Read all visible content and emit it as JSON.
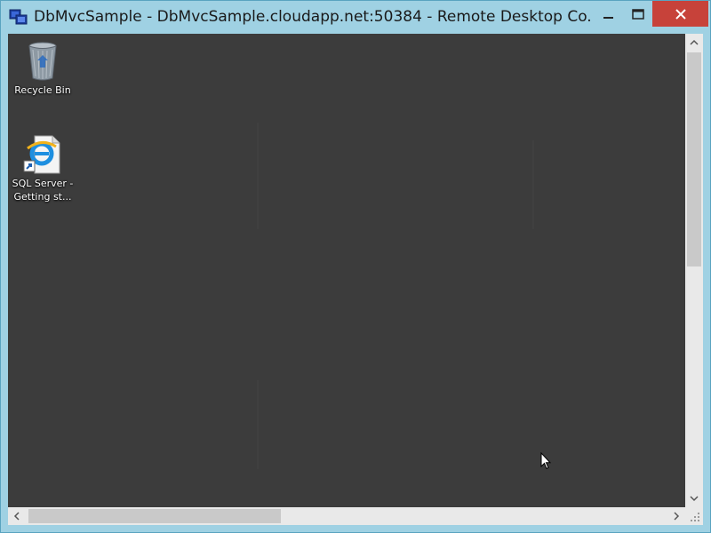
{
  "window": {
    "title": "DbMvcSample - DbMvcSample.cloudapp.net:50384 - Remote Desktop Co...",
    "icon": "remote-desktop-icon",
    "buttons": {
      "minimize_icon": "minimize-icon",
      "maximize_icon": "maximize-icon",
      "close_icon": "close-icon"
    },
    "colors": {
      "frame": "#9fd1e3",
      "close_button": "#c7423a",
      "desktop_background": "#3c3c3c"
    }
  },
  "desktop": {
    "icons": [
      {
        "label": "Recycle Bin",
        "icon": "recycle-bin-icon"
      },
      {
        "label": "SQL Server -\nGetting st...",
        "icon": "internet-explorer-shortcut-icon"
      }
    ]
  },
  "scrollbars": {
    "vertical": {
      "position": 0.0,
      "visible_fraction": 0.46
    },
    "horizontal": {
      "position": 0.0,
      "visible_fraction": 0.4
    }
  }
}
